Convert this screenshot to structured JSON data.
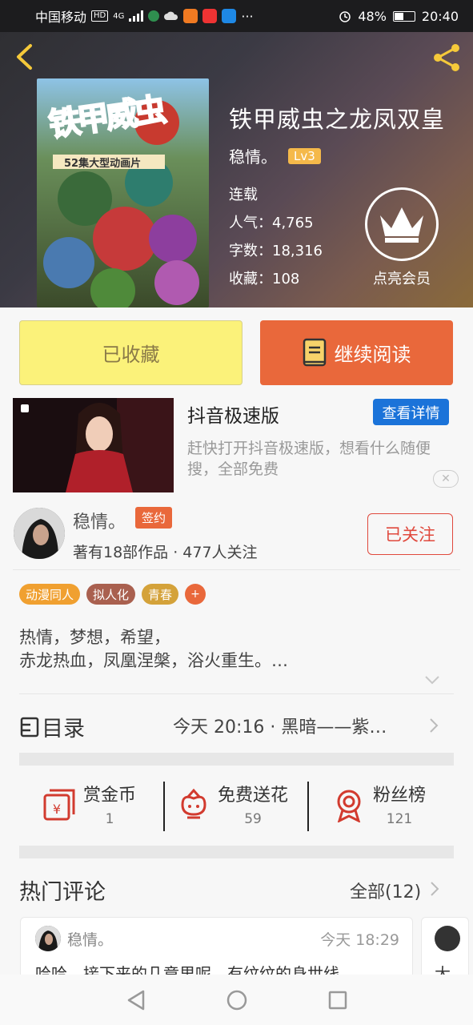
{
  "status_bar": {
    "carrier": "中国移动",
    "hd_badge": "HD",
    "network": "4G",
    "battery": "48%",
    "time": "20:40"
  },
  "book": {
    "title": "铁甲威虫之龙凤双皇",
    "author": "稳情。",
    "level": "Lv3",
    "status": "连载",
    "popularity": "人气：4,765",
    "word_count": "字数：18,316",
    "favorites": "收藏：108",
    "cover_title_art": "铁甲威虫",
    "cover_subtitle": "52集大型动画片"
  },
  "vip": {
    "label": "点亮会员"
  },
  "actions": {
    "collected_label": "已收藏",
    "continue_label": "继续阅读"
  },
  "ad": {
    "title": "抖音极速版",
    "detail_button": "查看详情",
    "description": "赶快打开抖音极速版，想看什么随便搜，全部免费",
    "close_symbol": "✕"
  },
  "author_info": {
    "name": "稳情。",
    "signed_badge": "签约",
    "stats": "著有18部作品 · 477人关注",
    "follow_button": "已关注"
  },
  "tags": [
    {
      "label": "动漫同人",
      "color": "#f0a030"
    },
    {
      "label": "拟人化",
      "color": "#a9604f"
    },
    {
      "label": "青春",
      "color": "#d4a23a"
    }
  ],
  "tag_more": "+",
  "intro": {
    "line1": "热情，梦想，希望，",
    "line2": "赤龙热血，凤凰涅槃，浴火重生。…"
  },
  "catalog": {
    "title": "目录",
    "latest": "今天 20:16 · 黑暗——紫…"
  },
  "rewards": [
    {
      "label": "赏金币",
      "count": "1"
    },
    {
      "label": "免费送花",
      "count": "59"
    },
    {
      "label": "粉丝榜",
      "count": "121"
    }
  ],
  "hot_comments": {
    "title": "热门评论",
    "all_label": "全部(12)",
    "items": [
      {
        "user": "稳情。",
        "time": "今天 18:29",
        "text": "哈哈，接下来的几章里呢，有纹纹的身世线"
      },
      {
        "text": "大"
      }
    ]
  },
  "colors": {
    "accent_orange": "#e9683b",
    "collected_yellow": "#fbf27a",
    "follow_red": "#e0493d",
    "ad_blue": "#1b73d9"
  }
}
